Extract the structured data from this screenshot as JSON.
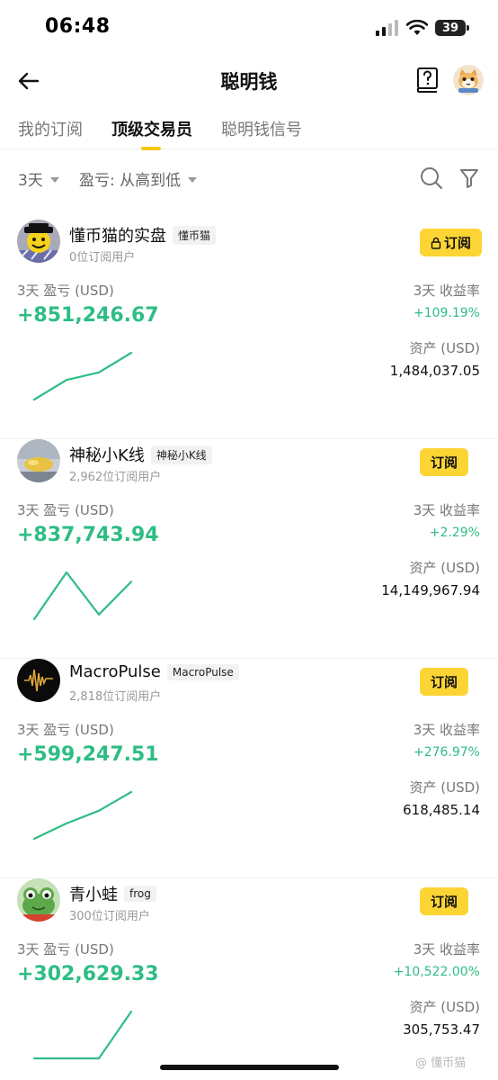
{
  "status_bar": {
    "time": "06:48",
    "battery": "39"
  },
  "header": {
    "title": "聪明钱"
  },
  "tabs": [
    {
      "label": "我的订阅",
      "active": false
    },
    {
      "label": "顶级交易员",
      "active": true
    },
    {
      "label": "聪明钱信号",
      "active": false
    }
  ],
  "filters": {
    "period": "3天",
    "sort": "盈亏: 从高到低"
  },
  "colors": {
    "accent": "#fcd535",
    "positive": "#2ebd85",
    "indicator": "#f7c815"
  },
  "traders": [
    {
      "name": "懂币猫的实盘",
      "tag": "懂币猫",
      "subscribers": "0位订阅用户",
      "subscribe_label": "订阅",
      "locked": true,
      "pnl_label": "3天 盈亏 (USD)",
      "pnl": "+851,246.67",
      "roi_label": "3天 收益率",
      "roi": "+109.19%",
      "assets_label": "资产 (USD)",
      "assets": "1,484,037.05",
      "trend": [
        0,
        0.42,
        0.58,
        1
      ]
    },
    {
      "name": "神秘小K线",
      "tag": "神秘小K线",
      "subscribers": "2,962位订阅用户",
      "subscribe_label": "订阅",
      "locked": false,
      "pnl_label": "3天 盈亏 (USD)",
      "pnl": "+837,743.94",
      "roi_label": "3天 收益率",
      "roi": "+2.29%",
      "assets_label": "资产 (USD)",
      "assets": "14,149,967.94",
      "trend": [
        0,
        1,
        0.1,
        0.8
      ]
    },
    {
      "name": "MacroPulse",
      "tag": "MacroPulse",
      "subscribers": "2,818位订阅用户",
      "subscribe_label": "订阅",
      "locked": false,
      "pnl_label": "3天 盈亏 (USD)",
      "pnl": "+599,247.51",
      "roi_label": "3天 收益率",
      "roi": "+276.97%",
      "assets_label": "资产 (USD)",
      "assets": "618,485.14",
      "trend": [
        0,
        0.33,
        0.6,
        1
      ]
    },
    {
      "name": "青小蛙",
      "tag": "frog",
      "subscribers": "300位订阅用户",
      "subscribe_label": "订阅",
      "locked": false,
      "pnl_label": "3天 盈亏 (USD)",
      "pnl": "+302,629.33",
      "roi_label": "3天 收益率",
      "roi": "+10,522.00%",
      "assets_label": "资产 (USD)",
      "assets": "305,753.47",
      "trend": [
        0,
        0,
        0,
        1
      ]
    }
  ],
  "watermark": "@ 懂币猫"
}
